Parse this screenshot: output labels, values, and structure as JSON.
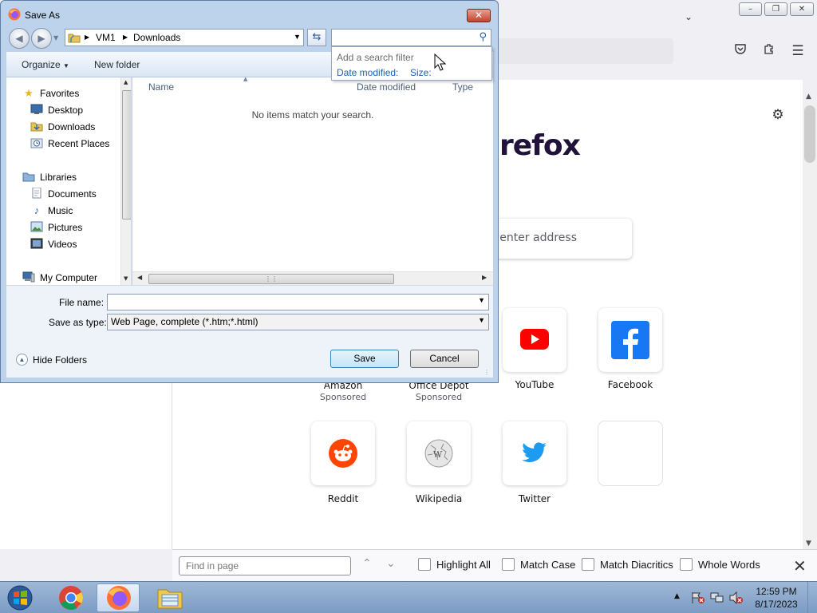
{
  "firefox": {
    "brand_text": "refox",
    "search_placeholder": "r enter address",
    "tiles": [
      {
        "label": "Amazon",
        "sub": "Sponsored"
      },
      {
        "label": "Office Depot",
        "sub": "Sponsored"
      },
      {
        "label": "YouTube",
        "sub": ""
      },
      {
        "label": "Facebook",
        "sub": ""
      },
      {
        "label": "Reddit",
        "sub": ""
      },
      {
        "label": "Wikipedia",
        "sub": ""
      },
      {
        "label": "Twitter",
        "sub": ""
      },
      {
        "label": "",
        "sub": ""
      }
    ],
    "colors": {
      "youtube": "#ff0000",
      "facebook": "#1877f2",
      "reddit": "#ff4500",
      "twitter": "#1d9bf0",
      "brand": "#20123a"
    }
  },
  "findbar": {
    "placeholder": "Find in page",
    "highlight_all": "Highlight All",
    "match_case": "Match Case",
    "match_diacritics": "Match Diacritics",
    "whole_words": "Whole Words"
  },
  "dialog": {
    "title": "Save As",
    "path": [
      "VM1",
      "Downloads"
    ],
    "search_value": "",
    "search_hint": "Add a search filter",
    "filters": [
      "Date modified:",
      "Size:"
    ],
    "toolbar": {
      "organize": "Organize",
      "new_folder": "New folder"
    },
    "nav": {
      "favorites": "Favorites",
      "desktop": "Desktop",
      "downloads": "Downloads",
      "recent": "Recent Places",
      "libraries": "Libraries",
      "documents": "Documents",
      "music": "Music",
      "pictures": "Pictures",
      "videos": "Videos",
      "computer": "My Computer"
    },
    "columns": [
      "Name",
      "Date modified",
      "Type"
    ],
    "empty_message": "No items match your search.",
    "file_name_label": "File name:",
    "file_name_value": "",
    "save_type_label": "Save as type:",
    "save_type_value": "Web Page, complete (*.htm;*.html)",
    "save_button": "Save",
    "cancel_button": "Cancel",
    "hide_folders": "Hide Folders"
  },
  "taskbar": {
    "time": "12:59 PM",
    "date": "8/17/2023"
  }
}
